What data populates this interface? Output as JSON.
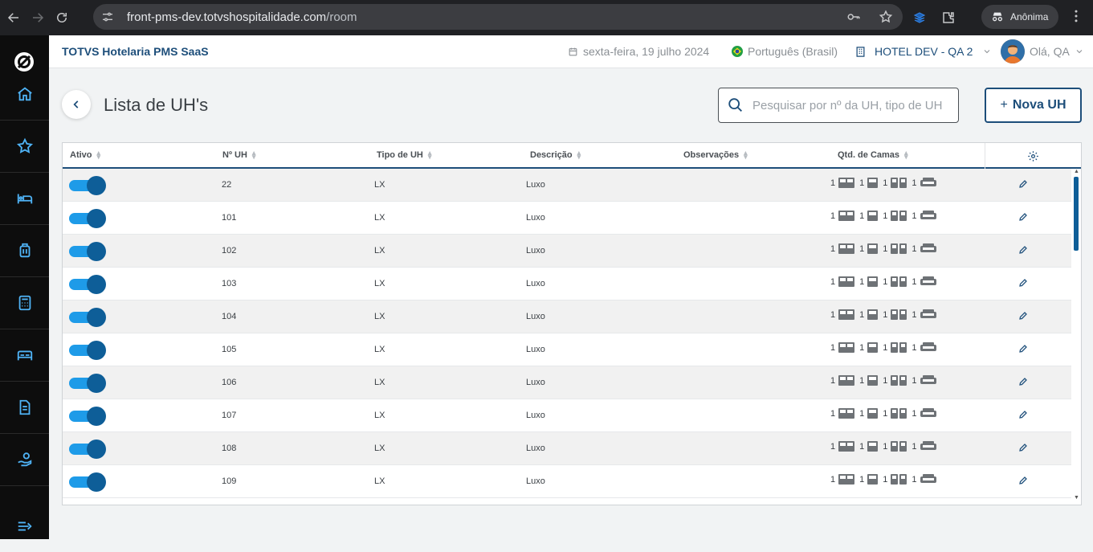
{
  "browser": {
    "url_host": "front-pms-dev.totvshospitalidade.com",
    "url_path": "/room",
    "profile_label": "Anônima"
  },
  "header": {
    "brand": "TOTVS Hotelaria PMS SaaS",
    "date": "sexta-feira, 19 julho 2024",
    "language": "Português (Brasil)",
    "hotel": "HOTEL DEV - QA 2",
    "greeting": "Olá, QA"
  },
  "sidebar": {
    "items": [
      {
        "icon": "home-icon"
      },
      {
        "icon": "star-icon"
      },
      {
        "icon": "bed-single-icon"
      },
      {
        "icon": "luggage-icon"
      },
      {
        "icon": "calculator-icon"
      },
      {
        "icon": "bed-double-icon"
      },
      {
        "icon": "document-icon"
      },
      {
        "icon": "hand-money-icon"
      }
    ]
  },
  "page": {
    "title": "Lista de UH's",
    "search_placeholder": "Pesquisar por nº da UH, tipo de UH",
    "new_button": "Nova UH",
    "new_button_prefix": "+"
  },
  "table": {
    "columns": [
      "Ativo",
      "Nº UH",
      "Tipo de UH",
      "Descrição",
      "Observações",
      "Qtd. de Camas"
    ],
    "rows": [
      {
        "active": true,
        "number": "22",
        "type": "LX",
        "description": "Luxo",
        "notes": "",
        "beds": [
          "1",
          "1",
          "1",
          "1"
        ]
      },
      {
        "active": true,
        "number": "101",
        "type": "LX",
        "description": "Luxo",
        "notes": "",
        "beds": [
          "1",
          "1",
          "1",
          "1"
        ]
      },
      {
        "active": true,
        "number": "102",
        "type": "LX",
        "description": "Luxo",
        "notes": "",
        "beds": [
          "1",
          "1",
          "1",
          "1"
        ]
      },
      {
        "active": true,
        "number": "103",
        "type": "LX",
        "description": "Luxo",
        "notes": "",
        "beds": [
          "1",
          "1",
          "1",
          "1"
        ]
      },
      {
        "active": true,
        "number": "104",
        "type": "LX",
        "description": "Luxo",
        "notes": "",
        "beds": [
          "1",
          "1",
          "1",
          "1"
        ]
      },
      {
        "active": true,
        "number": "105",
        "type": "LX",
        "description": "Luxo",
        "notes": "",
        "beds": [
          "1",
          "1",
          "1",
          "1"
        ]
      },
      {
        "active": true,
        "number": "106",
        "type": "LX",
        "description": "Luxo",
        "notes": "",
        "beds": [
          "1",
          "1",
          "1",
          "1"
        ]
      },
      {
        "active": true,
        "number": "107",
        "type": "LX",
        "description": "Luxo",
        "notes": "",
        "beds": [
          "1",
          "1",
          "1",
          "1"
        ]
      },
      {
        "active": true,
        "number": "108",
        "type": "LX",
        "description": "Luxo",
        "notes": "",
        "beds": [
          "1",
          "1",
          "1",
          "1"
        ]
      },
      {
        "active": true,
        "number": "109",
        "type": "LX",
        "description": "Luxo",
        "notes": "",
        "beds": [
          "1",
          "1",
          "1",
          "1"
        ]
      }
    ]
  },
  "colors": {
    "brand": "#1d4e7a",
    "toggle_track": "#1e9be8",
    "toggle_knob": "#0e5e98",
    "sidebar_icon": "#4fb3f6"
  }
}
